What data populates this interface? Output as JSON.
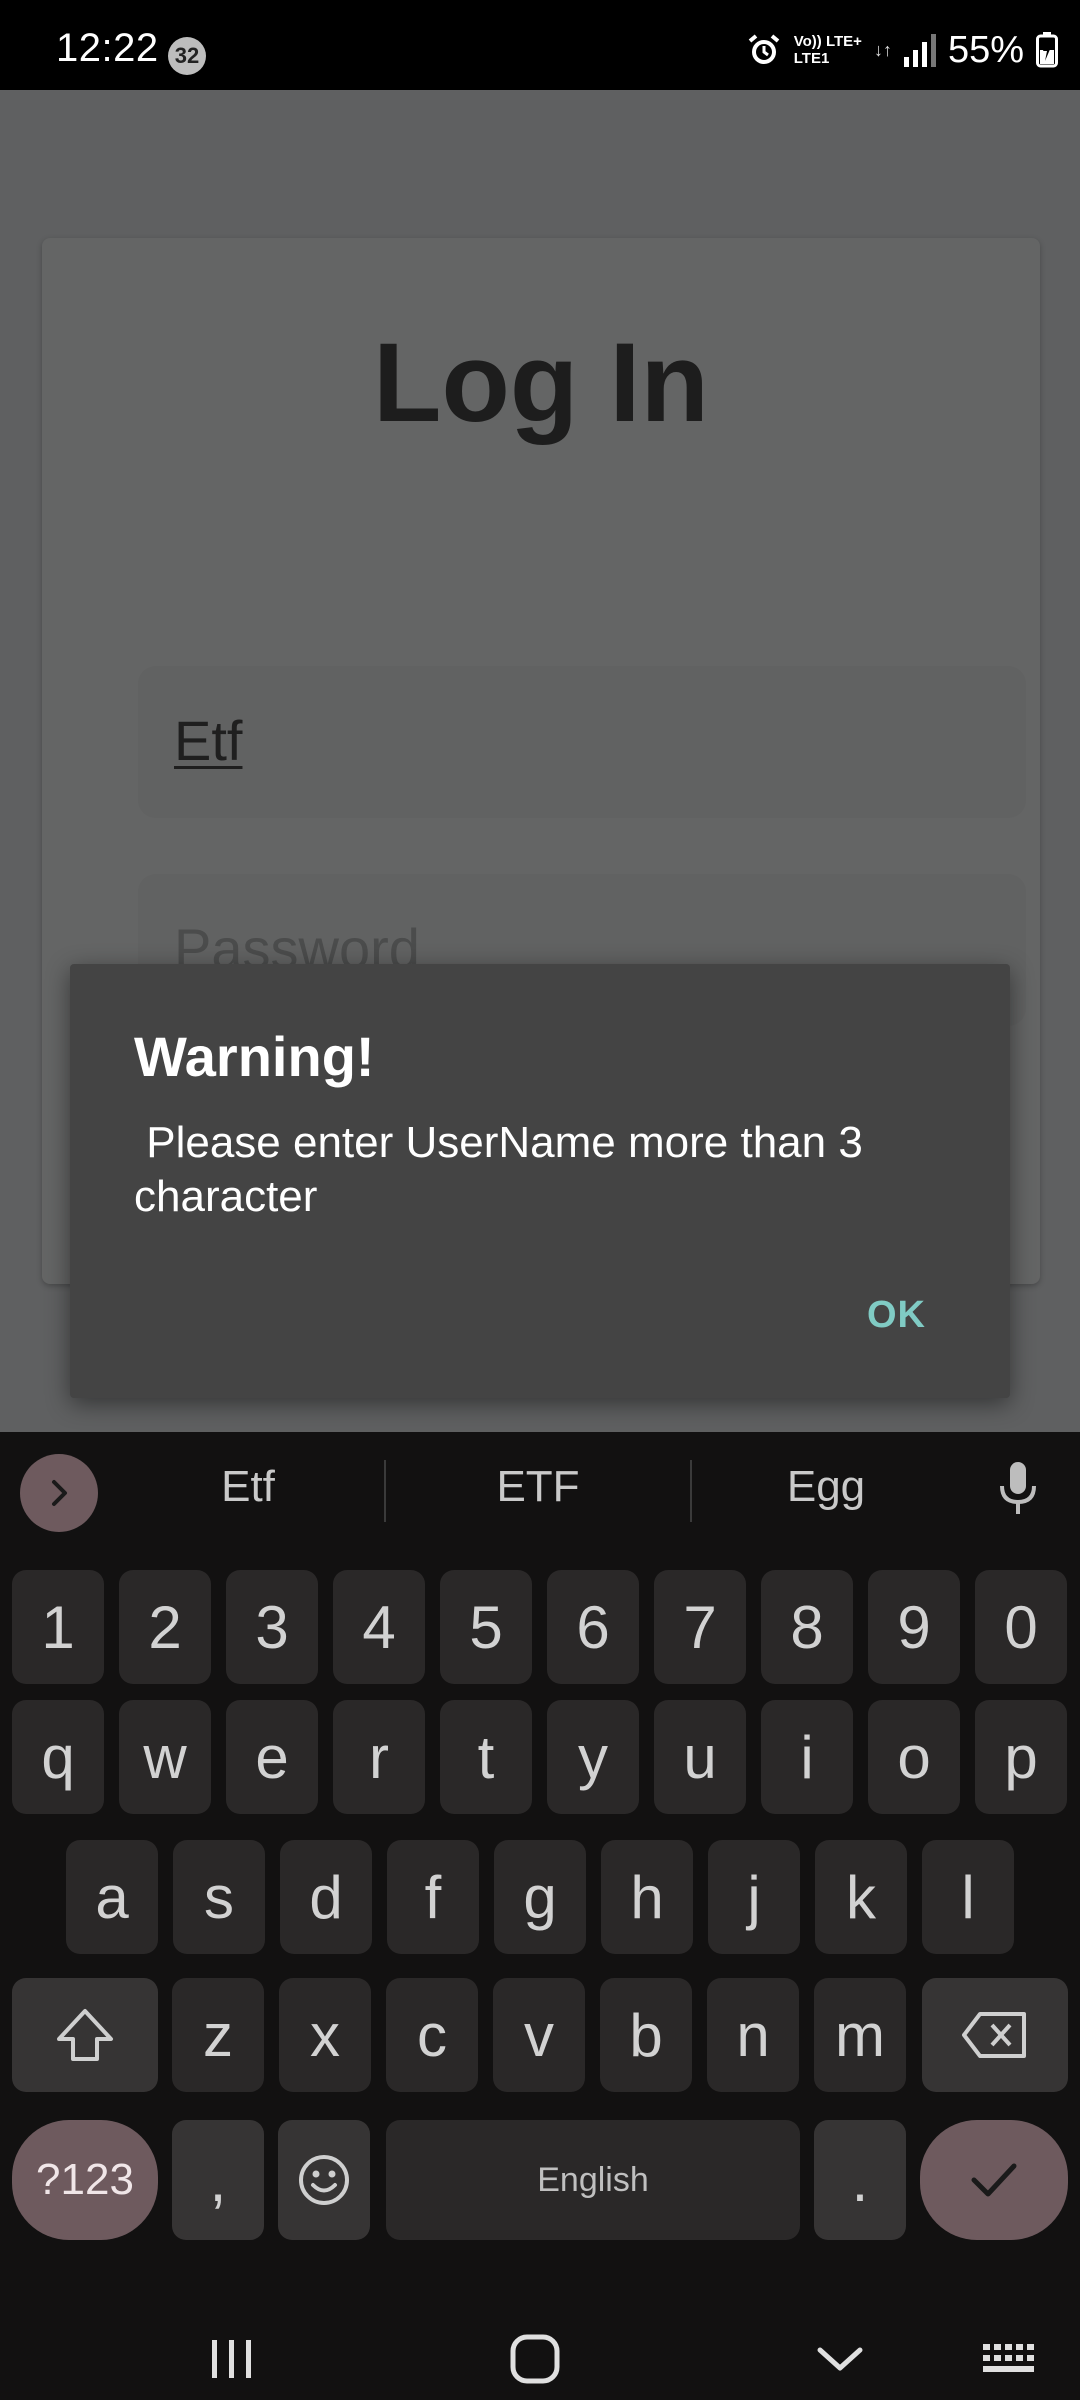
{
  "status_bar": {
    "time": "12:22",
    "notification_count": "32",
    "network_top": "Vo)) LTE+",
    "network_bottom": "LTE1",
    "data_arrows": "↓↑",
    "battery_percent": "55%"
  },
  "login": {
    "title": "Log In",
    "username_value": "Etf",
    "password_placeholder": "Password"
  },
  "dialog": {
    "title": "Warning!",
    "message": " Please enter UserName more than 3\ncharacter",
    "ok_label": "OK"
  },
  "keyboard": {
    "suggestions": [
      "Etf",
      "ETF",
      "Egg"
    ],
    "row_numbers": [
      "1",
      "2",
      "3",
      "4",
      "5",
      "6",
      "7",
      "8",
      "9",
      "0"
    ],
    "row_top": [
      "q",
      "w",
      "e",
      "r",
      "t",
      "y",
      "u",
      "i",
      "o",
      "p"
    ],
    "row_middle": [
      "a",
      "s",
      "d",
      "f",
      "g",
      "h",
      "j",
      "k",
      "l"
    ],
    "row_bottom": [
      "z",
      "x",
      "c",
      "v",
      "b",
      "n",
      "m"
    ],
    "symbols_label": "?123",
    "comma_label": ",",
    "space_label": "English",
    "period_label": ".",
    "accent_color": "#6e5a5e"
  },
  "icons": {
    "alarm": "alarm-icon",
    "signal": "signal-icon",
    "battery": "battery-charging-icon",
    "suggestion_toggle": "chevron-right-icon",
    "mic": "mic-icon",
    "shift": "shift-icon",
    "backspace": "backspace-icon",
    "emoji": "emoji-icon",
    "enter": "checkmark-icon",
    "nav_recents": "recents-icon",
    "nav_home": "home-icon",
    "nav_back": "back-chevron-icon",
    "nav_keyboard": "keyboard-icon"
  }
}
